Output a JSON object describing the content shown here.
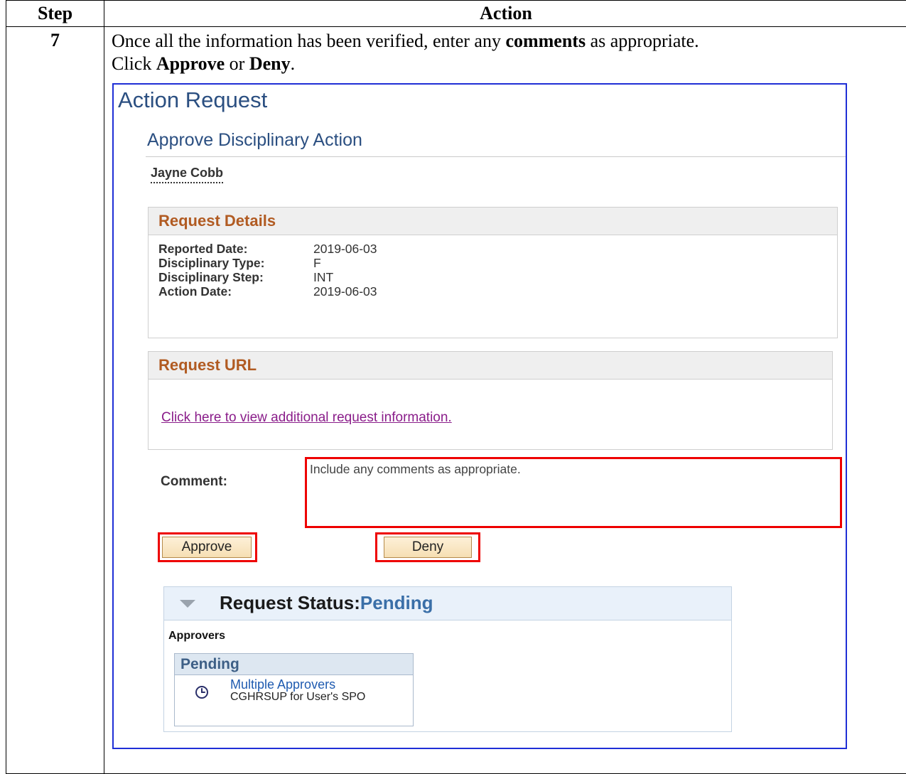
{
  "table": {
    "header_step": "Step",
    "header_action": "Action",
    "step_number": "7",
    "instruction": {
      "line1_pre": "Once all the information has been verified, enter any ",
      "line1_bold": "comments",
      "line1_post": " as appropriate.",
      "line2_pre": "Click ",
      "line2_bold1": "Approve",
      "line2_mid": " or ",
      "line2_bold2": "Deny",
      "line2_post": "."
    }
  },
  "screen": {
    "title": "Action Request",
    "subtitle": "Approve Disciplinary Action",
    "person": "Jayne Cobb",
    "request_details": {
      "heading": "Request Details",
      "rows": [
        {
          "label": "Reported Date:",
          "value": "2019-06-03"
        },
        {
          "label": "Disciplinary Type:",
          "value": "F"
        },
        {
          "label": "Disciplinary Step:",
          "value": "INT"
        },
        {
          "label": "Action Date:",
          "value": "2019-06-03"
        }
      ]
    },
    "request_url": {
      "heading": "Request URL",
      "link_text": "Click here to view additional request information."
    },
    "comment": {
      "label": "Comment:",
      "value": "Include any comments as appropriate."
    },
    "buttons": {
      "approve": "Approve",
      "deny": "Deny"
    },
    "status": {
      "title_label": "Request Status:",
      "title_value": "Pending",
      "approvers_label": "Approvers",
      "pending_heading": "Pending",
      "approver_name": "Multiple Approvers",
      "approver_role": "CGHRSUP for User's SPO"
    },
    "colors": {
      "highlight": "#e00000",
      "frame": "#1f2fd6",
      "section_heading": "#b15b22",
      "link": "#8a1d8a"
    },
    "icons": [
      "collapse-triangle-icon",
      "clock-icon"
    ]
  }
}
